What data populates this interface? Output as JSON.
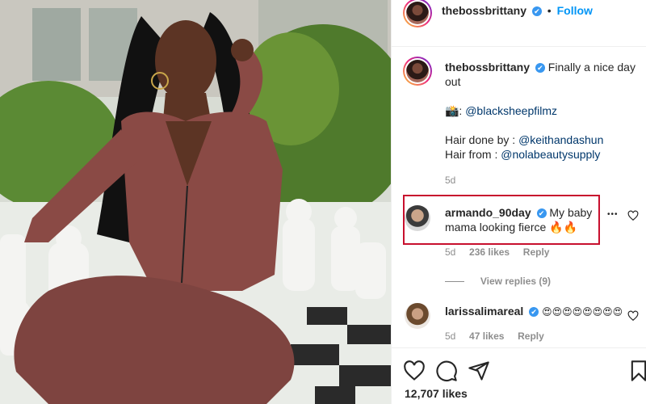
{
  "header": {
    "username": "thebossbrittany",
    "verified": "✔",
    "separator": "•",
    "follow_label": "Follow"
  },
  "caption": {
    "username": "thebossbrittany",
    "verified": "✔",
    "text_line1": "Finally a nice day",
    "text_line2": "out",
    "camera_glyph": "📸:",
    "photographer": "@blacksheepfilmz",
    "hair_done_prefix": "Hair done by : ",
    "hair_done_handle": "@keithandashun",
    "hair_from_prefix": "Hair from : ",
    "hair_from_handle": "@nolabeautysupply",
    "time": "5d"
  },
  "comments": [
    {
      "username": "armando_90day",
      "verified": "✔",
      "text_line1": "My baby",
      "text_line2": "mama looking fierce 🔥🔥",
      "time": "5d",
      "likes": "236 likes",
      "reply": "Reply",
      "more": "•••",
      "view_replies": "View replies (9)"
    },
    {
      "username": "larissalimareal",
      "verified": "✔",
      "text": "😍😍😍😍😍😍😍😍",
      "time": "5d",
      "likes": "47 likes",
      "reply": "Reply"
    }
  ],
  "footer": {
    "likes_count": "12,707 likes"
  },
  "icons": {
    "heart": "heart-icon",
    "comment": "comment-icon",
    "share": "share-icon",
    "save": "bookmark-icon",
    "more": "more-options-icon"
  },
  "colors": {
    "verified_blue": "#3897f0",
    "follow_blue": "#0095f6",
    "link_navy": "#00376b",
    "highlight_red": "#c8102e",
    "outfit_mauve": "#8a4a45"
  }
}
